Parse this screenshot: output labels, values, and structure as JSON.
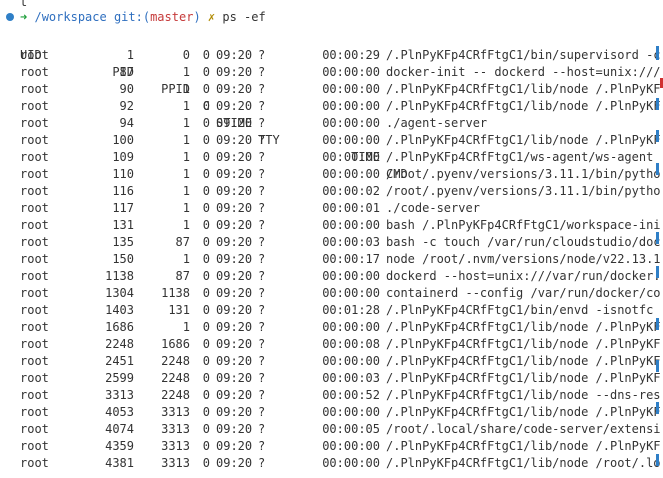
{
  "top_fragment": "t",
  "prompt": {
    "arrow": "➜",
    "path": "/workspace",
    "git": "git:(",
    "branch": "master",
    "git_close": ")",
    "x": "✗",
    "command": "ps -ef"
  },
  "headers": {
    "uid": "UID",
    "pid": "PID",
    "ppid": "PPID",
    "c": "C",
    "stime": "STIME",
    "tty": "TTY",
    "time": "TIME",
    "cmd": "CMD"
  },
  "rows": [
    {
      "uid": "root",
      "pid": "1",
      "ppid": "0",
      "c": "0",
      "stime": "09:20",
      "tty": "?",
      "time": "00:00:29",
      "cmd": "/.PlnPyKFp4CRfFtgC1/bin/supervisord -c"
    },
    {
      "uid": "root",
      "pid": "87",
      "ppid": "1",
      "c": "0",
      "stime": "09:20",
      "tty": "?",
      "time": "00:00:00",
      "cmd": "docker-init -- dockerd --host=unix:///"
    },
    {
      "uid": "root",
      "pid": "90",
      "ppid": "1",
      "c": "0",
      "stime": "09:20",
      "tty": "?",
      "time": "00:00:00",
      "cmd": "/.PlnPyKFp4CRfFtgC1/lib/node /.PlnPyKF"
    },
    {
      "uid": "root",
      "pid": "92",
      "ppid": "1",
      "c": "0",
      "stime": "09:20",
      "tty": "?",
      "time": "00:00:00",
      "cmd": "/.PlnPyKFp4CRfFtgC1/lib/node /.PlnPyKF"
    },
    {
      "uid": "root",
      "pid": "94",
      "ppid": "1",
      "c": "0",
      "stime": "09:20",
      "tty": "?",
      "time": "00:00:00",
      "cmd": "./agent-server"
    },
    {
      "uid": "root",
      "pid": "100",
      "ppid": "1",
      "c": "0",
      "stime": "09:20",
      "tty": "?",
      "time": "00:00:00",
      "cmd": "/.PlnPyKFp4CRfFtgC1/lib/node /.PlnPyKF"
    },
    {
      "uid": "root",
      "pid": "109",
      "ppid": "1",
      "c": "0",
      "stime": "09:20",
      "tty": "?",
      "time": "00:00:00",
      "cmd": "/.PlnPyKFp4CRfFtgC1/ws-agent/ws-agent"
    },
    {
      "uid": "root",
      "pid": "110",
      "ppid": "1",
      "c": "0",
      "stime": "09:20",
      "tty": "?",
      "time": "00:00:00",
      "cmd": "/root/.pyenv/versions/3.11.1/bin/pytho"
    },
    {
      "uid": "root",
      "pid": "116",
      "ppid": "1",
      "c": "0",
      "stime": "09:20",
      "tty": "?",
      "time": "00:00:02",
      "cmd": "/root/.pyenv/versions/3.11.1/bin/pytho"
    },
    {
      "uid": "root",
      "pid": "117",
      "ppid": "1",
      "c": "0",
      "stime": "09:20",
      "tty": "?",
      "time": "00:00:01",
      "cmd": "./code-server"
    },
    {
      "uid": "root",
      "pid": "131",
      "ppid": "1",
      "c": "0",
      "stime": "09:20",
      "tty": "?",
      "time": "00:00:00",
      "cmd": "bash /.PlnPyKFp4CRfFtgC1/workspace-ini"
    },
    {
      "uid": "root",
      "pid": "135",
      "ppid": "87",
      "c": "0",
      "stime": "09:20",
      "tty": "?",
      "time": "00:00:03",
      "cmd": "bash -c touch /var/run/cloudstudio/doc"
    },
    {
      "uid": "root",
      "pid": "150",
      "ppid": "1",
      "c": "0",
      "stime": "09:20",
      "tty": "?",
      "time": "00:00:17",
      "cmd": "node /root/.nvm/versions/node/v22.13.1"
    },
    {
      "uid": "root",
      "pid": "1138",
      "ppid": "87",
      "c": "0",
      "stime": "09:20",
      "tty": "?",
      "time": "00:00:00",
      "cmd": "dockerd --host=unix:///var/run/docker."
    },
    {
      "uid": "root",
      "pid": "1304",
      "ppid": "1138",
      "c": "0",
      "stime": "09:20",
      "tty": "?",
      "time": "00:00:00",
      "cmd": "containerd --config /var/run/docker/co"
    },
    {
      "uid": "root",
      "pid": "1403",
      "ppid": "131",
      "c": "0",
      "stime": "09:20",
      "tty": "?",
      "time": "00:01:28",
      "cmd": "/.PlnPyKFp4CRfFtgC1/bin/envd -isnotfc"
    },
    {
      "uid": "root",
      "pid": "1686",
      "ppid": "1",
      "c": "0",
      "stime": "09:20",
      "tty": "?",
      "time": "00:00:00",
      "cmd": "/.PlnPyKFp4CRfFtgC1/lib/node /.PlnPyKF"
    },
    {
      "uid": "root",
      "pid": "2248",
      "ppid": "1686",
      "c": "0",
      "stime": "09:20",
      "tty": "?",
      "time": "00:00:08",
      "cmd": "/.PlnPyKFp4CRfFtgC1/lib/node /.PlnPyKF"
    },
    {
      "uid": "root",
      "pid": "2451",
      "ppid": "2248",
      "c": "0",
      "stime": "09:20",
      "tty": "?",
      "time": "00:00:00",
      "cmd": "/.PlnPyKFp4CRfFtgC1/lib/node /.PlnPyKF"
    },
    {
      "uid": "root",
      "pid": "2599",
      "ppid": "2248",
      "c": "0",
      "stime": "09:20",
      "tty": "?",
      "time": "00:00:03",
      "cmd": "/.PlnPyKFp4CRfFtgC1/lib/node /.PlnPyKF"
    },
    {
      "uid": "root",
      "pid": "3313",
      "ppid": "2248",
      "c": "0",
      "stime": "09:20",
      "tty": "?",
      "time": "00:00:52",
      "cmd": "/.PlnPyKFp4CRfFtgC1/lib/node --dns-res"
    },
    {
      "uid": "root",
      "pid": "4053",
      "ppid": "3313",
      "c": "0",
      "stime": "09:20",
      "tty": "?",
      "time": "00:00:00",
      "cmd": "/.PlnPyKFp4CRfFtgC1/lib/node /.PlnPyKF"
    },
    {
      "uid": "root",
      "pid": "4074",
      "ppid": "3313",
      "c": "0",
      "stime": "09:20",
      "tty": "?",
      "time": "00:00:05",
      "cmd": "/root/.local/share/code-server/extensi"
    },
    {
      "uid": "root",
      "pid": "4359",
      "ppid": "3313",
      "c": "0",
      "stime": "09:20",
      "tty": "?",
      "time": "00:00:00",
      "cmd": "/.PlnPyKFp4CRfFtgC1/lib/node /.PlnPyKF"
    },
    {
      "uid": "root",
      "pid": "4381",
      "ppid": "3313",
      "c": "0",
      "stime": "09:20",
      "tty": "?",
      "time": "00:00:00",
      "cmd": "/.PlnPyKFp4CRfFtgC1/lib/node /root/.lo"
    }
  ],
  "colors": {
    "dot": "#2f7fc7",
    "arrow": "#1e9e3a",
    "path": "#2f6fbf",
    "branch": "#c63a3a",
    "x": "#b08a00",
    "marker_blue": "#2f7fc7",
    "marker_red": "#d03030"
  }
}
